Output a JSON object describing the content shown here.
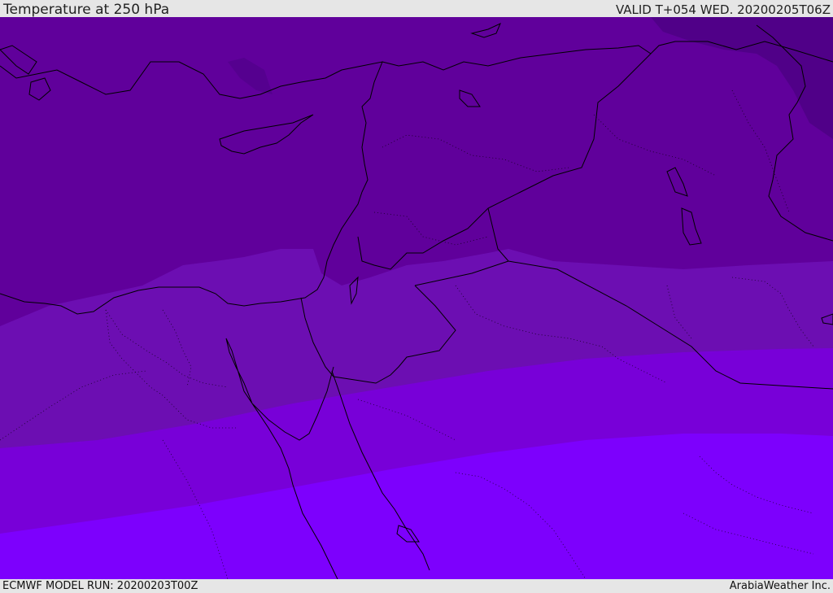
{
  "header": {
    "title": "Temperature at 250 hPa",
    "valid_time": "VALID T+054 WED. 20200205T06Z"
  },
  "footer": {
    "model_run": "ECMWF MODEL RUN: 20200203T00Z",
    "credit": "ArabiaWeather Inc."
  },
  "map": {
    "colors": {
      "band_darkest": "#4f0086",
      "band_dark": "#60009b",
      "band_mid": "#6c0eb2",
      "band_light": "#7800d8",
      "band_lightest": "#7d00fd",
      "coastline": "#000000"
    },
    "icons": [
      "coastline-overlay",
      "border-overlay"
    ]
  }
}
